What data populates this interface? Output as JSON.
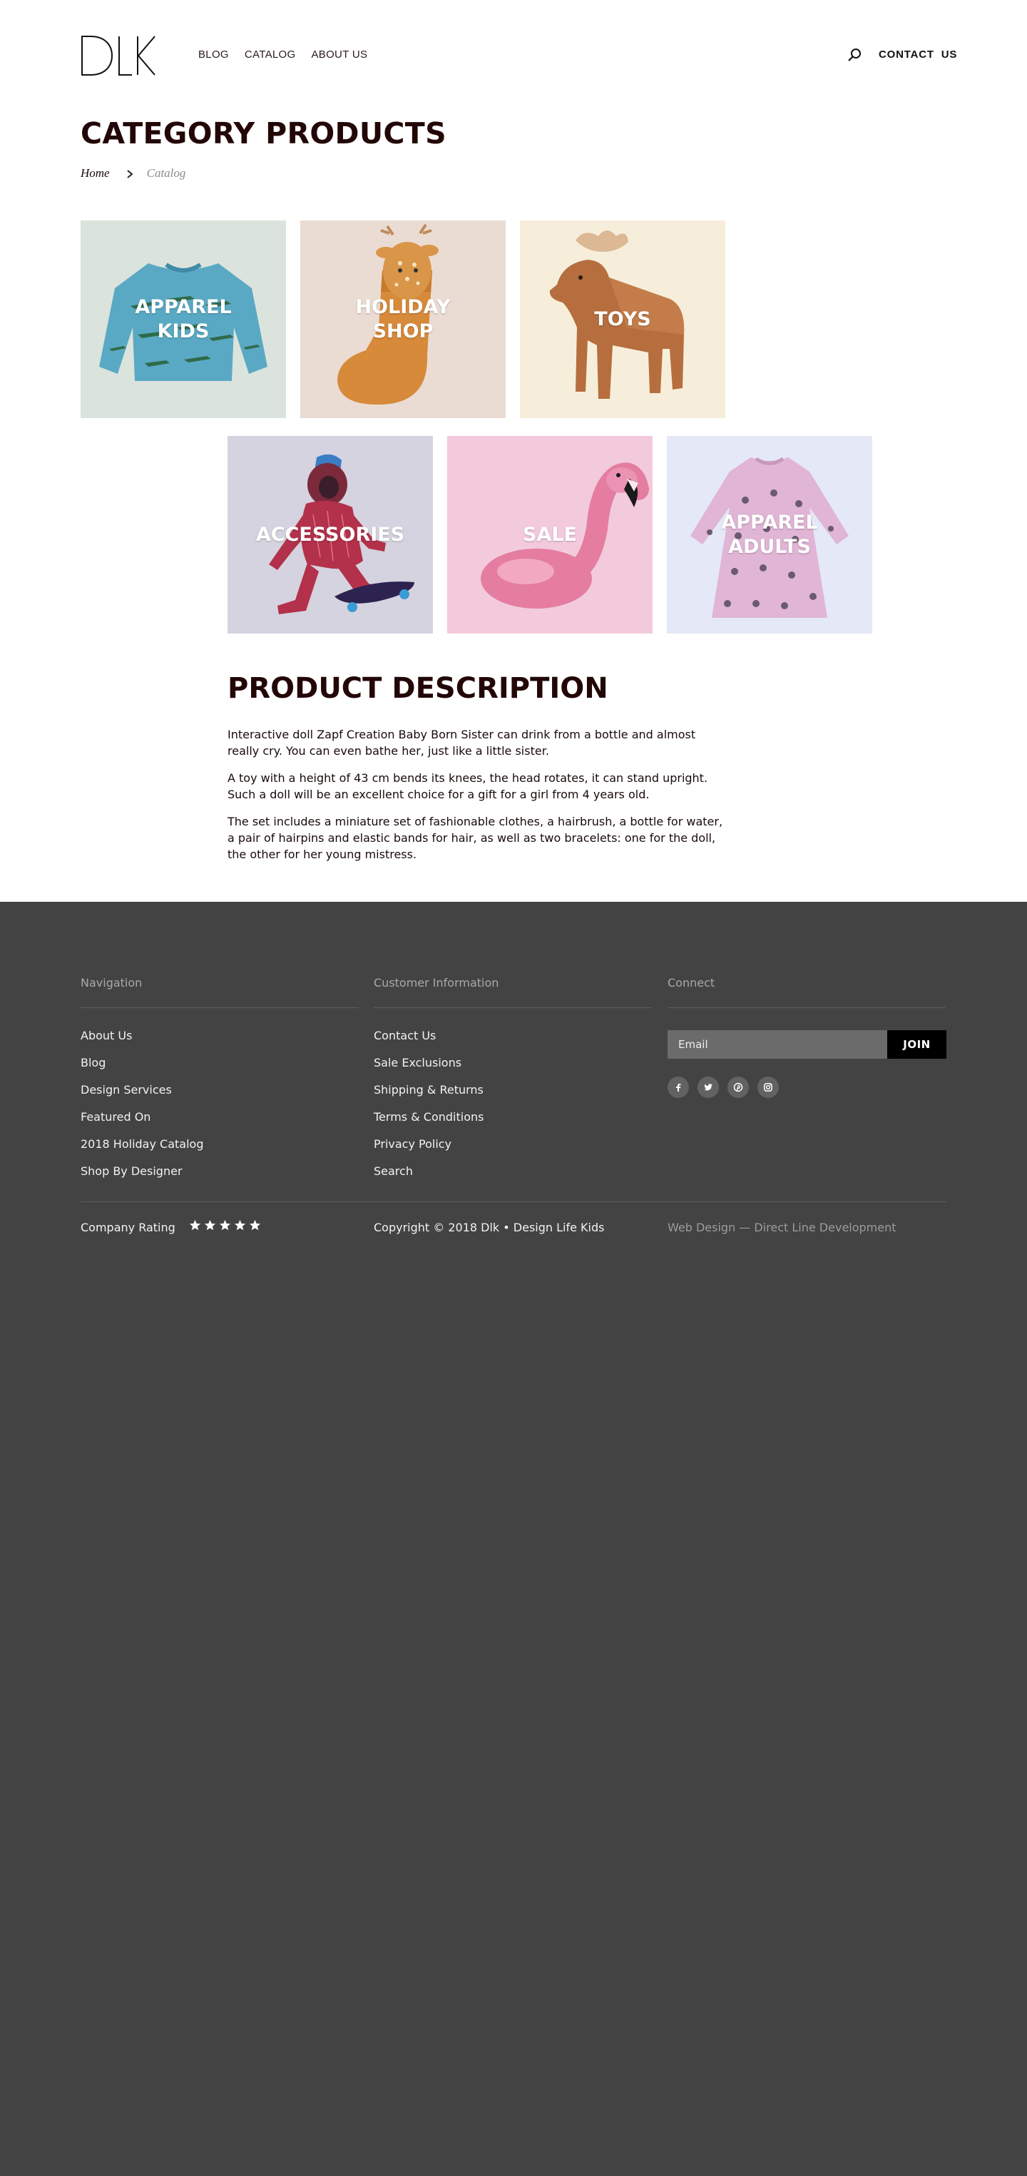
{
  "header": {
    "logo_text": "DLK",
    "nav": [
      "BLOG",
      "CATALOG",
      "ABOUT US"
    ],
    "search_icon": "search-icon",
    "contact_label": "CONTACT  US"
  },
  "page": {
    "title": "CATEGORY PRODUCTS",
    "breadcrumb": {
      "home": "Home",
      "current": "Catalog"
    }
  },
  "categories": [
    {
      "label": "APPAREL KIDS",
      "bg": "#dbe3dd",
      "image": "blue crocodile sweater"
    },
    {
      "label": "HOLIDAY SHOP",
      "bg": "#eadcd3",
      "image": "deer christmas stocking"
    },
    {
      "label": "TOYS",
      "bg": "#f6eeda",
      "image": "wooden moose toy"
    },
    {
      "label": "ACCESSORIES",
      "bg": "#d5d3df",
      "image": "bigfoot on skateboard"
    },
    {
      "label": "SALE",
      "bg": "#f2cadb",
      "image": "flamingo pool float"
    },
    {
      "label": "APPAREL ADULTS",
      "bg": "#e5e8f7",
      "image": "pink bunny print dress"
    }
  ],
  "description": {
    "title": "PRODUCT DESCRIPTION",
    "paragraphs": [
      "Interactive doll Zapf Creation Baby Born Sister can drink from a bottle and almost really cry. You can even bathe her, just like a little sister.",
      "A toy with a height of 43 cm bends its knees, the head rotates, it can stand upright. Such a doll will be an excellent choice for a gift for a girl from 4 years old.",
      "The set includes a miniature set of fashionable clothes, a hairbrush, a bottle for water, a pair of hairpins and elastic bands for hair, as well as two bracelets: one for the doll, the other for her young mistress."
    ]
  },
  "footer": {
    "navigation": {
      "title": "Navigation",
      "items": [
        "About Us",
        "Blog",
        "Design Services",
        "Featured On",
        "2018 Holiday Catalog",
        "Shop By Designer"
      ]
    },
    "customer_info": {
      "title": "Customer Information",
      "items": [
        "Contact Us",
        "Sale Exclusions",
        "Shipping & Returns",
        "Terms & Conditions",
        "Privacy Policy",
        "Search"
      ]
    },
    "connect": {
      "title": "Connect",
      "email_placeholder": "Email",
      "join_label": "JOIN",
      "socials": [
        "facebook-icon",
        "twitter-icon",
        "pinterest-icon",
        "instagram-icon"
      ]
    },
    "rating_label": "Company Rating",
    "rating_stars": 5,
    "copyright": "Copyright © 2018 Dlk • Design Life Kids",
    "credit": "Web Design — Direct Line Development"
  },
  "colors": {
    "title": "#230707",
    "footer_bg": "#434343",
    "join_bg": "#000000"
  }
}
